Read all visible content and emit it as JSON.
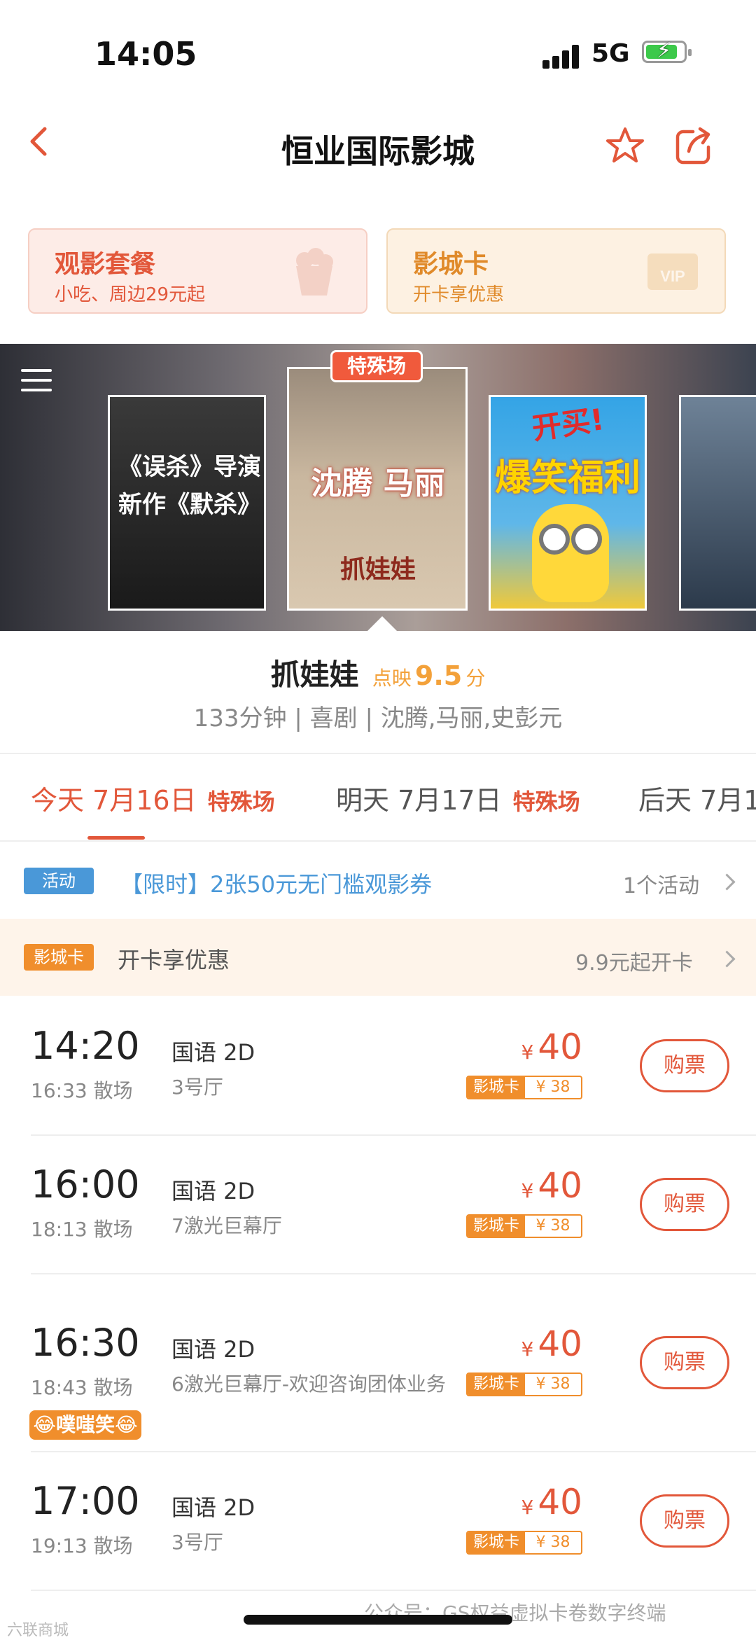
{
  "status_bar": {
    "time": "14:05",
    "network": "5G",
    "battery_level": 0.85
  },
  "nav": {
    "title": "恒业国际影城",
    "back_icon": "chevron-left-icon",
    "favorite_icon": "star-icon",
    "share_icon": "share-icon"
  },
  "promos": [
    {
      "title": "观影套餐",
      "subtitle": "小吃、周边29元起",
      "icon": "popcorn-icon"
    },
    {
      "title": "影城卡",
      "subtitle": "开卡享优惠",
      "icon": "vip-card-icon"
    }
  ],
  "posters": {
    "special_tag": "特殊场",
    "p1_text": "《误杀》导演新作《默杀》",
    "p2_cast": "沈腾 马丽",
    "p2_title": "抓娃娃",
    "p3_line1": "开买!",
    "p3_line2": "爆笑福利场"
  },
  "movie": {
    "name": "抓娃娃",
    "score_label": "点映",
    "score": "9.5",
    "score_unit": "分",
    "meta": "133分钟 | 喜剧 | 沈腾,马丽,史彭元"
  },
  "date_tabs": [
    {
      "label": "今天 7月16日",
      "tag": "特殊场",
      "active": true
    },
    {
      "label": "明天 7月17日",
      "tag": "特殊场",
      "active": false
    },
    {
      "label": "后天 7月1",
      "tag": "",
      "active": false
    }
  ],
  "activity": {
    "badge": "活动",
    "text": "【限时】2张50元无门槛观影券",
    "count": "1个活动"
  },
  "card": {
    "badge": "影城卡",
    "text": "开卡享优惠",
    "right": "9.9元起开卡"
  },
  "showtimes": [
    {
      "start": "14:20",
      "end": "16:33 散场",
      "lang": "国语 2D",
      "hall": "3号厅",
      "currency": "¥",
      "price": "40",
      "card_label": "影城卡",
      "card_price": "¥ 38",
      "buy": "购票"
    },
    {
      "start": "16:00",
      "end": "18:13 散场",
      "lang": "国语 2D",
      "hall": "7激光巨幕厅",
      "currency": "¥",
      "price": "40",
      "card_label": "影城卡",
      "card_price": "¥ 38",
      "buy": "购票"
    },
    {
      "start": "16:30",
      "end": "18:43 散场",
      "lang": "国语 2D",
      "hall": "6激光巨幕厅-欢迎咨询团体业务",
      "currency": "¥",
      "price": "40",
      "card_label": "影城卡",
      "card_price": "¥ 38",
      "buy": "购票",
      "badge": "😂噗嗤笑😂"
    },
    {
      "start": "17:00",
      "end": "19:13 散场",
      "lang": "国语 2D",
      "hall": "3号厅",
      "currency": "¥",
      "price": "40",
      "card_label": "影城卡",
      "card_price": "¥ 38",
      "buy": "购票"
    }
  ],
  "watermark": {
    "left": "六联商城",
    "right": "公众号：GS权益虚拟卡卷数字终端"
  }
}
